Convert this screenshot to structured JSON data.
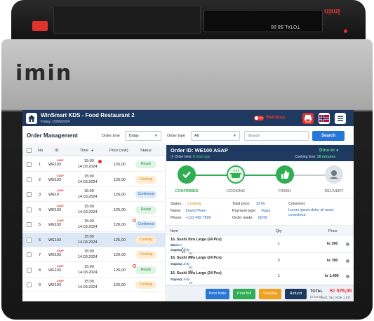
{
  "device": {
    "brand_logo": "imin",
    "small_screen_text": "TOTAL:$8.88",
    "brand_logo_red": "imin"
  },
  "header": {
    "title": "WinSmart KDS  - Food Restaurant 2",
    "date": "Friday, 15/06/2024",
    "toggle_label": "OFF",
    "webshop_label": "Webshop"
  },
  "toolbar": {
    "section_title": "Order Management",
    "order_time_label": "Order time",
    "order_time_value": "Today",
    "order_type_label": "Order type",
    "order_type_value": "All",
    "search_placeholder": "Search",
    "search_button": "Search"
  },
  "table": {
    "headers": {
      "no": "No.",
      "id": "ID",
      "time": "Time",
      "price": "Price (nok)",
      "status": "Status"
    },
    "asap_tag": "ASAP",
    "rows": [
      {
        "no": "1",
        "id": "WE193",
        "time": "15:00",
        "date": "14.03.2024",
        "price": "126,00",
        "status": "Ready"
      },
      {
        "no": "2",
        "id": "WE193",
        "time": "15:00",
        "date": "14.03.2024",
        "price": "126,00",
        "status": "Cooking"
      },
      {
        "no": "3",
        "id": "WE19",
        "time": "15:00",
        "date": "14.03.2024",
        "price": "126,00",
        "status": "Confirmed"
      },
      {
        "no": "4",
        "id": "WE193",
        "time": "15:00",
        "date": "14.03.2024",
        "price": "126,00",
        "status": "Ready"
      },
      {
        "no": "5",
        "id": "WE193",
        "time": "15:00",
        "date": "14.03.2024",
        "price": "126,00",
        "status": "Confirmed"
      },
      {
        "no": "6",
        "id": "WE193",
        "time": "15:00",
        "date": "14.03.2024",
        "price": "126,00",
        "status": "Cooking"
      },
      {
        "no": "7",
        "id": "WE193",
        "time": "15:00",
        "date": "14.03.2024",
        "price": "126,00",
        "status": "Cooking"
      },
      {
        "no": "8",
        "id": "WE193",
        "time": "15:00",
        "date": "14.03.2024",
        "price": "126,00",
        "status": "Ready"
      },
      {
        "no": "9",
        "id": "WE193",
        "time": "15:00",
        "date": "14.03.2024",
        "price": "126,00",
        "status": "Cooking"
      }
    ]
  },
  "order": {
    "id": "Order ID: WE100 ASAP",
    "order_time_label": "Order time:",
    "order_time_value": "8 mins ago",
    "dine_in": "Dine-in",
    "cooking_time_label": "Cooking time:",
    "cooking_time_value": "28 minutes",
    "steps": [
      "CONFIRMED",
      "COOKING",
      "FINISH",
      "DELIVERY"
    ],
    "status_label": "Status:",
    "status_value": "Cooking",
    "name_label": "Name:",
    "name_value": "David Pham",
    "phone_label": "Phone:",
    "phone_value": "+123 456 7899",
    "total_price_label": "Total price:",
    "total_price_value": "327kr",
    "payment_label": "Payment type:",
    "payment_value": "Vipps",
    "order_made_label": "Order made:",
    "order_made_value": "08:00",
    "comment_label": "Comment:",
    "comment_value": "Lorem ipsum dolor sit amet, consetetur.",
    "items_headers": {
      "item": "Item",
      "qty": "Qty",
      "price": "Price"
    },
    "items": [
      {
        "name": "16. Sushi Xtra Large (24 Pcs)",
        "size_label": "Size:",
        "size": "Medium",
        "size_price": " - Kr 40",
        "topping_label": "Topping:",
        "topping": "Coconut Jelly",
        "topping_price": " - Kr 40",
        "qty": "1",
        "price": "kr 390"
      },
      {
        "name": "16. Sushi Xtra Large (24 Pcs)",
        "topping_label": "Topping:",
        "topping": "Coconut Jelly",
        "topping_price": " - Kr 40",
        "qty": "2",
        "price": "kr 780"
      },
      {
        "name": "16. Sushi Xtra Large (24 Pcs)",
        "topping_label": "Topping:",
        "topping": "Coconut Jelly",
        "topping_price": " - Kr 40",
        "qty": "1",
        "price": "kr 1.490"
      }
    ],
    "buttons": {
      "print_note": "Print Note",
      "print_bill": "Print Bill",
      "sending": "Sending",
      "refund": "Refund"
    },
    "total_label": "TOTAL",
    "total_items": "(0 items)",
    "total_value": "Kr 576,00",
    "total_tax": "(incl. Tax: NOK 1.87)"
  },
  "colors": {
    "header_bg": "#1f3a60",
    "accent_blue": "#2877d6",
    "ready": "#1c8a3a",
    "cooking": "#d8860a",
    "confirmed": "#2466b8",
    "alert_red": "#e23333"
  }
}
